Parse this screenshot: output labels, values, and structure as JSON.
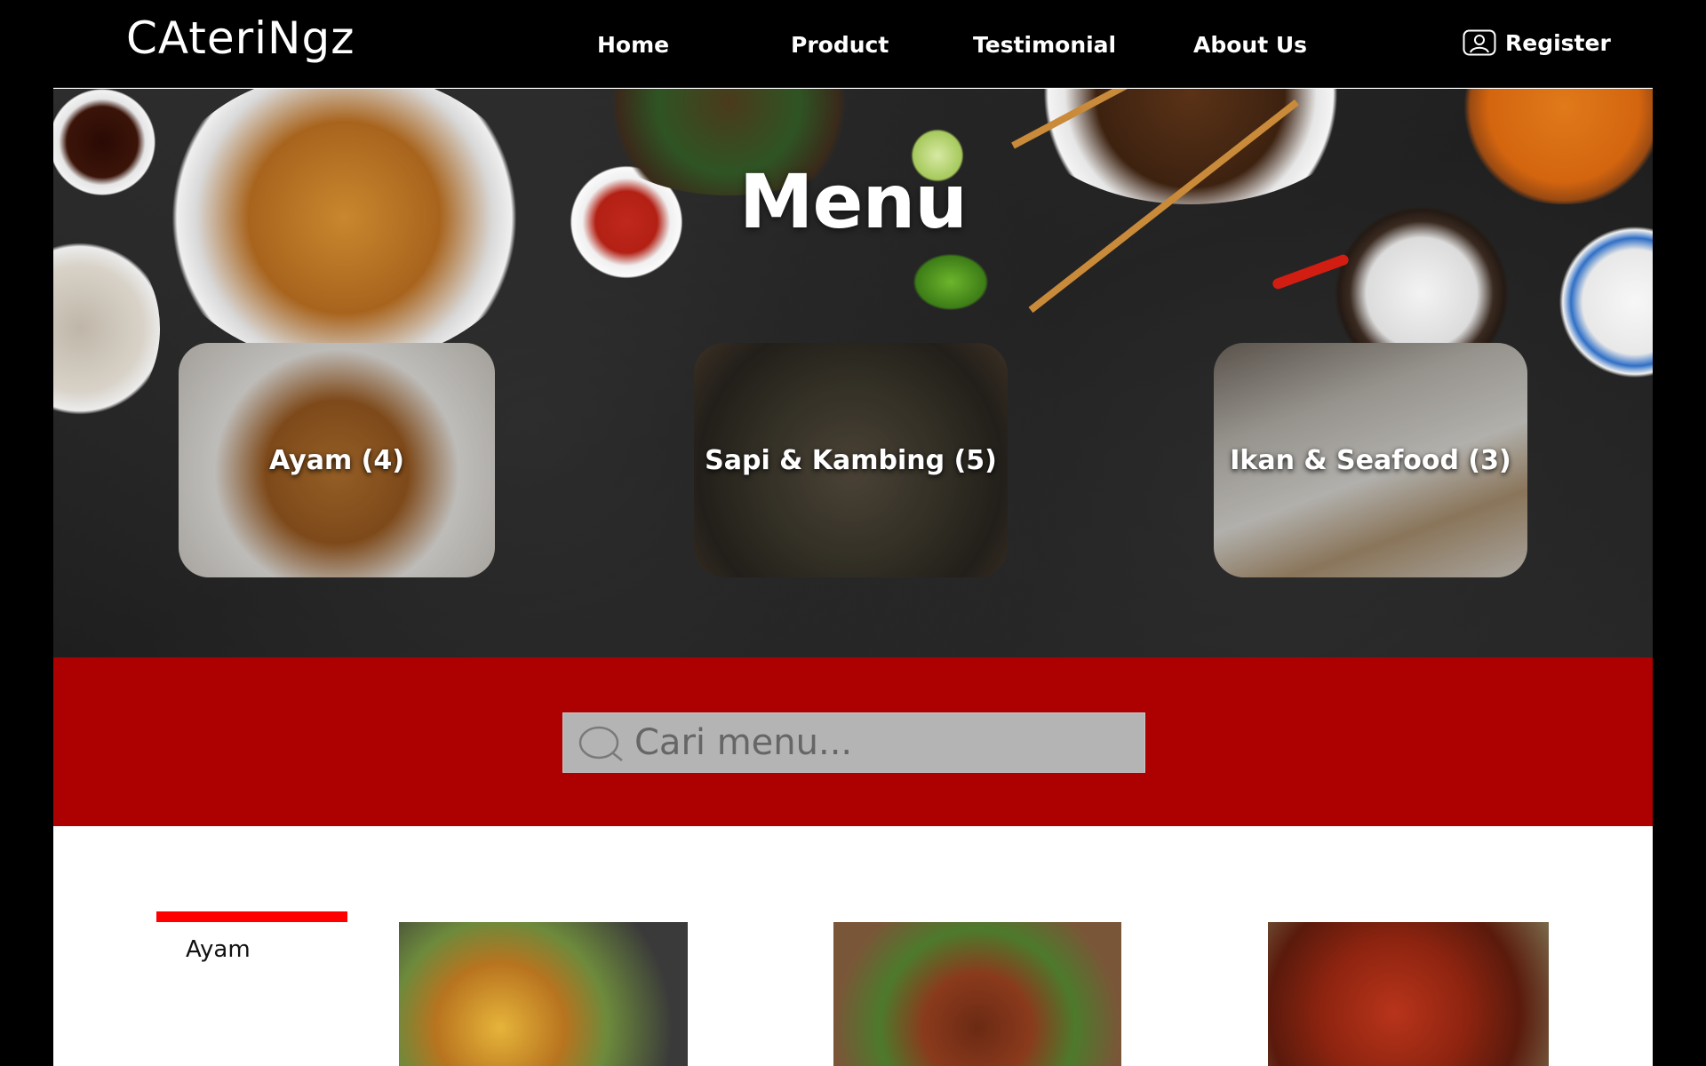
{
  "navbar": {
    "logo": "CAteriNgz",
    "links": [
      "Home",
      "Product",
      "Testimonial",
      "About Us"
    ],
    "register_label": "Register",
    "register_icon": "user-account-icon"
  },
  "hero": {
    "title": "Menu",
    "categories": [
      {
        "label": "Ayam (4)",
        "image": "roasted-chicken-photo"
      },
      {
        "label": "Sapi & Kambing (5)",
        "image": "beef-lamb-dish-photo"
      },
      {
        "label": "Ikan & Seafood (3)",
        "image": "grilled-fish-photo"
      }
    ]
  },
  "search": {
    "placeholder": "Cari menu...",
    "icon": "search-icon"
  },
  "sidebar": {
    "active_category": "Ayam"
  },
  "products": [
    {
      "image": "ayam-goreng-kremes-photo"
    },
    {
      "image": "ayam-bakar-photo"
    },
    {
      "image": "ayam-balado-photo"
    }
  ],
  "colors": {
    "navbar_bg": "#000000",
    "band_red": "#ad0000",
    "accent_red": "#ff0000",
    "search_bg": "#b4b4b4"
  }
}
